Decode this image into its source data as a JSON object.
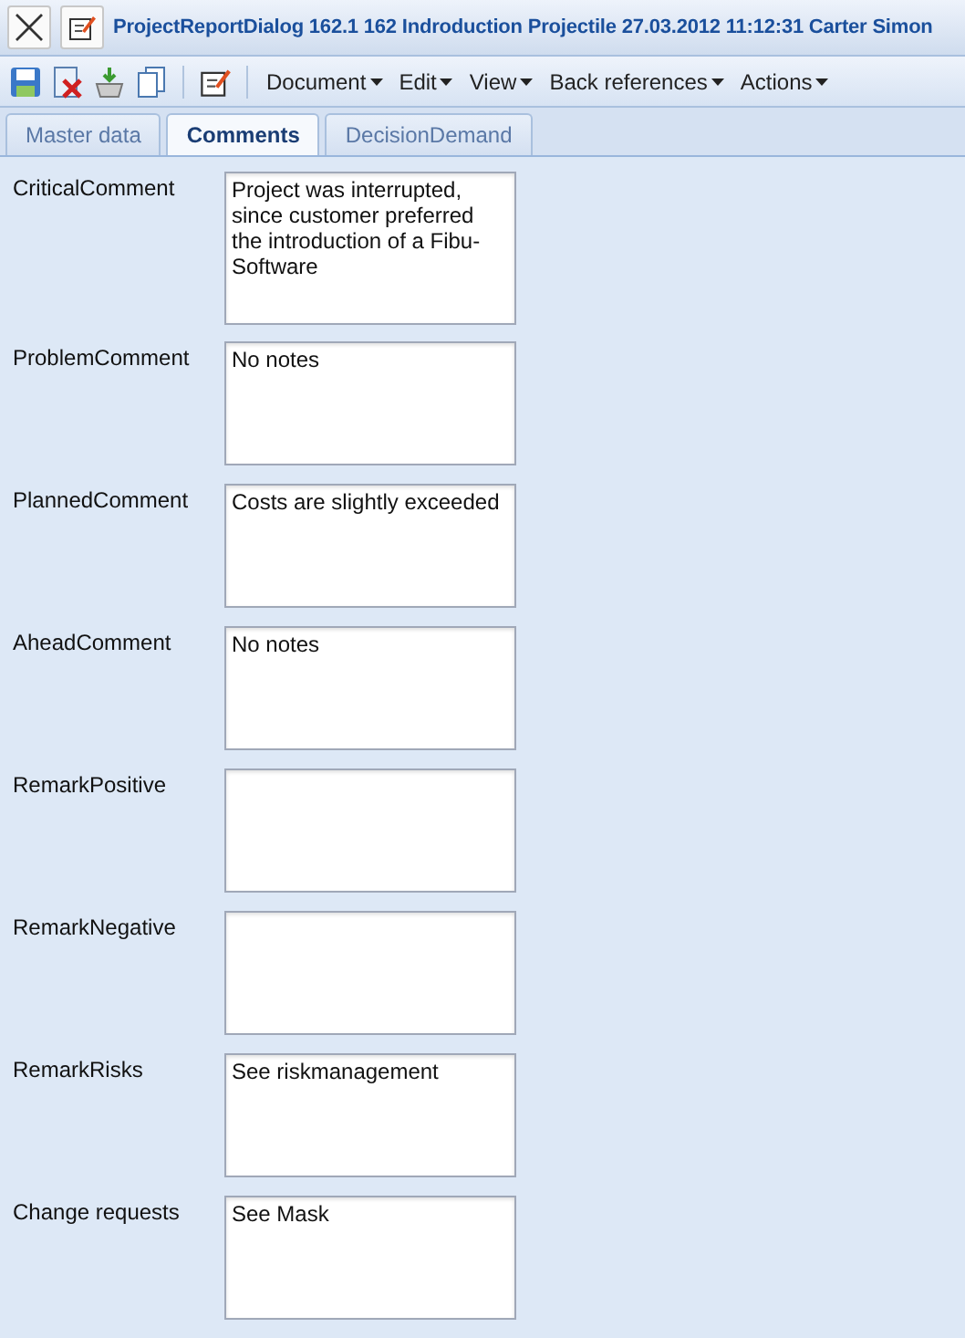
{
  "window": {
    "title": "ProjectReportDialog 162.1 162 Indroduction Projectile 27.03.2012 11:12:31 Carter Simon"
  },
  "menus": [
    {
      "label": "Document"
    },
    {
      "label": "Edit"
    },
    {
      "label": "View"
    },
    {
      "label": "Back references"
    },
    {
      "label": "Actions"
    }
  ],
  "tabs": [
    {
      "label": "Master data",
      "selected": false
    },
    {
      "label": "Comments",
      "selected": true
    },
    {
      "label": "DecisionDemand",
      "selected": false
    }
  ],
  "fields": [
    {
      "label": "CriticalComment",
      "value": "Project was interrupted, since customer preferred the introduction of a Fibu-Software"
    },
    {
      "label": "ProblemComment",
      "value": "No notes"
    },
    {
      "label": "PlannedComment",
      "value": "Costs are slightly exceeded"
    },
    {
      "label": "AheadComment",
      "value": "No notes"
    },
    {
      "label": "RemarkPositive"
    },
    {
      "label": "RemarkNegative"
    },
    {
      "label": "RemarkRisks",
      "value": "See riskmanagement"
    },
    {
      "label": "Change requests",
      "value": "See Mask"
    }
  ]
}
